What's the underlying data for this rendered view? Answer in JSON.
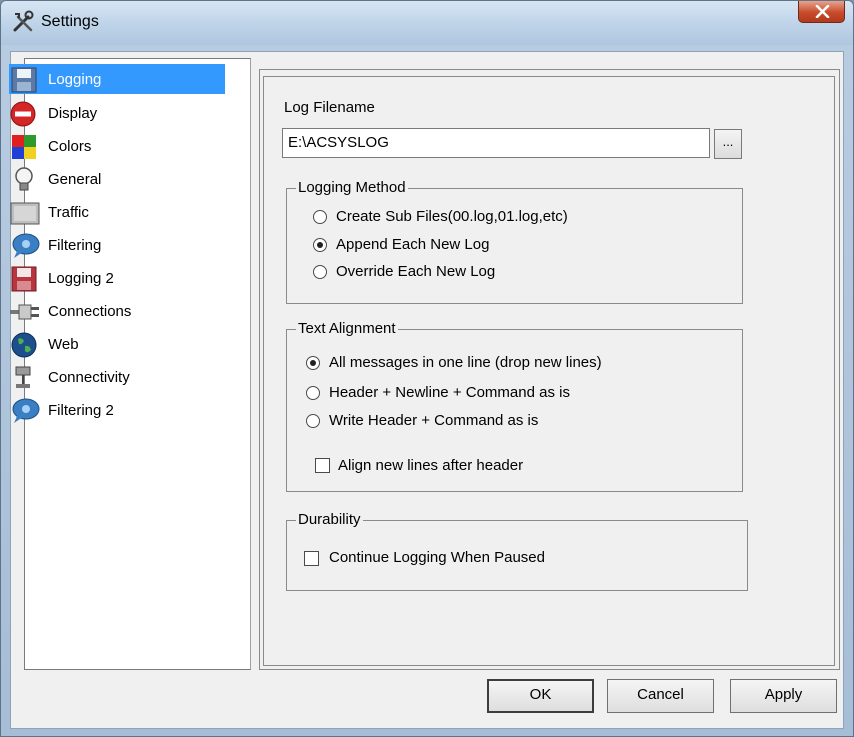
{
  "window": {
    "title": "Settings",
    "title_icon": "tools-icon",
    "close_icon": "close-icon"
  },
  "sidebar": {
    "items": [
      {
        "label": "Logging",
        "icon": "floppy-disk-icon",
        "selected": true
      },
      {
        "label": "Display",
        "icon": "no-entry-icon",
        "selected": false
      },
      {
        "label": "Colors",
        "icon": "color-squares-icon",
        "selected": false
      },
      {
        "label": "General",
        "icon": "light-bulb-icon",
        "selected": false
      },
      {
        "label": "Traffic",
        "icon": "gray-box-icon",
        "selected": false
      },
      {
        "label": "Filtering",
        "icon": "speech-bubble-icon",
        "selected": false
      },
      {
        "label": "Logging 2",
        "icon": "floppy-disk-red-icon",
        "selected": false
      },
      {
        "label": "Connections",
        "icon": "plug-icon",
        "selected": false
      },
      {
        "label": "Web",
        "icon": "globe-icon",
        "selected": false
      },
      {
        "label": "Connectivity",
        "icon": "network-icon",
        "selected": false
      },
      {
        "label": "Filtering 2",
        "icon": "speech-bubble-icon",
        "selected": false
      }
    ]
  },
  "log_file": {
    "label": "Log Filename",
    "value": "E:\\ACSYSLOG",
    "browse_label": "..."
  },
  "logging_method": {
    "legend": "Logging Method",
    "options": [
      {
        "label": "Create Sub Files(00.log,01.log,etc)",
        "checked": false
      },
      {
        "label": "Append Each New Log",
        "checked": true
      },
      {
        "label": "Override Each New Log",
        "checked": false
      }
    ]
  },
  "text_alignment": {
    "legend": "Text Alignment",
    "options": [
      {
        "label": "All messages in one line (drop new lines)",
        "checked": true
      },
      {
        "label": "Header + Newline + Command as is",
        "checked": false
      },
      {
        "label": "Write Header + Command as is",
        "checked": false
      }
    ],
    "align_checkbox": {
      "label": "Align new lines after header",
      "checked": false
    }
  },
  "durability": {
    "legend": "Durability",
    "continue_checkbox": {
      "label": "Continue Logging When Paused",
      "checked": false
    }
  },
  "buttons": {
    "ok": "OK",
    "cancel": "Cancel",
    "apply": "Apply"
  }
}
